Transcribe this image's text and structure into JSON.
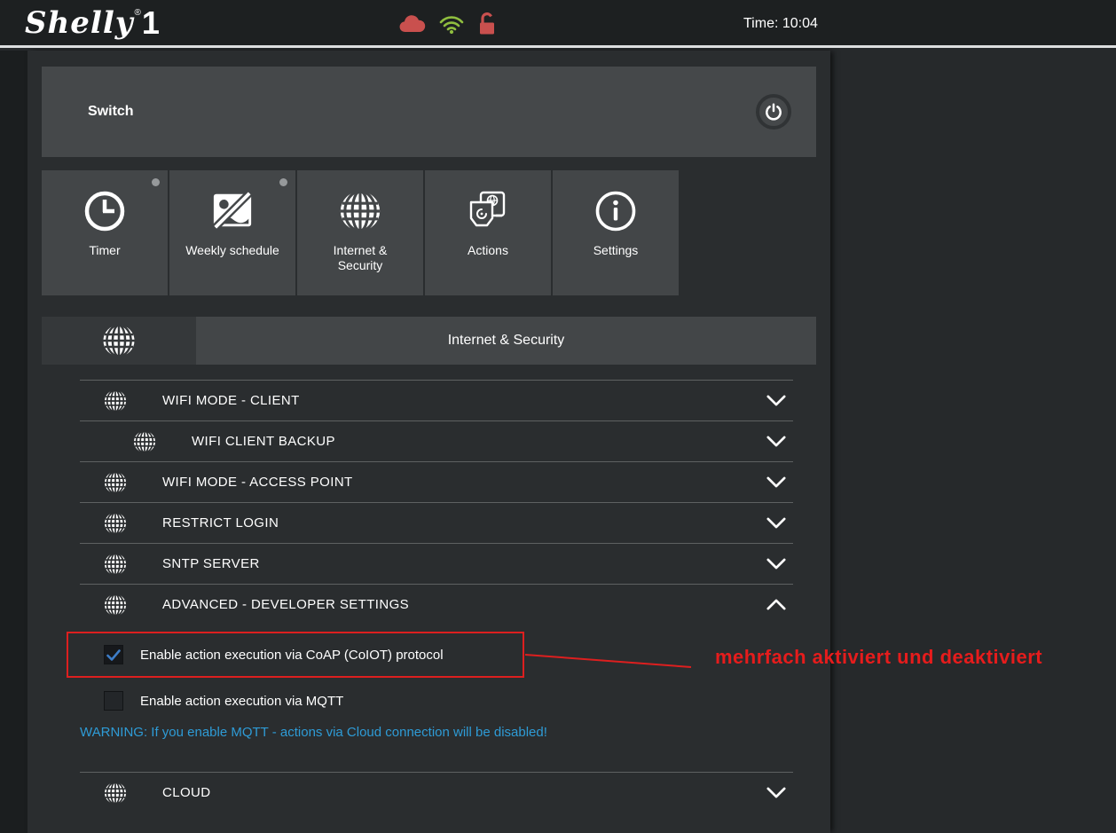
{
  "topbar": {
    "brand": "Shelly",
    "brand_reg": "®",
    "brand_model": "1",
    "time": "Time: 10:04"
  },
  "device": {
    "title": "Switch"
  },
  "tabs": [
    {
      "label": "Timer",
      "icon": "clock-icon",
      "dot": true
    },
    {
      "label": "Weekly schedule",
      "icon": "no-schedule-icon",
      "dot": true
    },
    {
      "label": "Internet & Security",
      "icon": "globe-icon",
      "dot": false
    },
    {
      "label": "Actions",
      "icon": "actions-icon",
      "dot": false
    },
    {
      "label": "Settings",
      "icon": "info-icon",
      "dot": false
    }
  ],
  "section": {
    "title": "Internet & Security"
  },
  "accordion": {
    "wifi_client": "WIFI MODE - CLIENT",
    "wifi_client_backup": "WIFI CLIENT BACKUP",
    "wifi_ap": "WIFI MODE - ACCESS POINT",
    "restrict_login": "RESTRICT LOGIN",
    "sntp": "SNTP SERVER",
    "advanced": "ADVANCED - DEVELOPER SETTINGS",
    "cloud": "CLOUD"
  },
  "advanced": {
    "coiot_label": "Enable action execution via CoAP (CoIOT) protocol",
    "coiot_checked": true,
    "mqtt_label": "Enable action execution via MQTT",
    "mqtt_checked": false,
    "warning": "WARNING: If you enable MQTT - actions via Cloud connection will be disabled!"
  },
  "annotation": {
    "text": "mehrfach aktiviert und deaktiviert"
  },
  "colors": {
    "cloud_red": "#c9504e",
    "wifi_green": "#8fbe3f",
    "lock_red": "#c9504e",
    "warning_blue": "#2e9bd6",
    "annotation_red": "#e61c1c",
    "check_blue": "#3d7dc8"
  }
}
